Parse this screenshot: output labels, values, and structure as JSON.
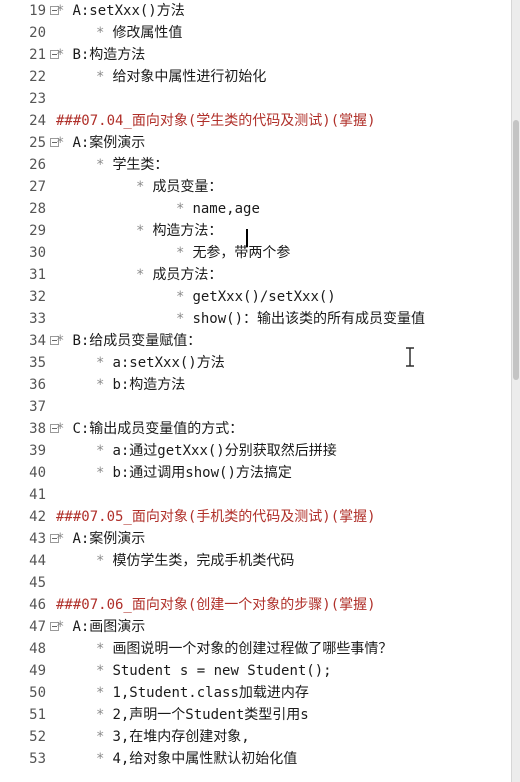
{
  "lines": [
    {
      "num": "19",
      "indent": 0,
      "bullet": "*",
      "text": "A:setXxx()方法",
      "heading": false,
      "fold": true
    },
    {
      "num": "20",
      "indent": 1,
      "bullet": "*",
      "text": "修改属性值",
      "heading": false,
      "fold": false
    },
    {
      "num": "21",
      "indent": 0,
      "bullet": "*",
      "text": "B:构造方法",
      "heading": false,
      "fold": true
    },
    {
      "num": "22",
      "indent": 1,
      "bullet": "*",
      "text": "给对象中属性进行初始化",
      "heading": false,
      "fold": false
    },
    {
      "num": "23",
      "indent": 0,
      "bullet": "",
      "text": "",
      "heading": false,
      "fold": false
    },
    {
      "num": "24",
      "indent": 0,
      "bullet": "",
      "text": "###07.04_面向对象(学生类的代码及测试)(掌握)",
      "heading": true,
      "fold": false
    },
    {
      "num": "25",
      "indent": 0,
      "bullet": "*",
      "text": "A:案例演示",
      "heading": false,
      "fold": true
    },
    {
      "num": "26",
      "indent": 1,
      "bullet": "*",
      "text": "学生类：",
      "heading": false,
      "fold": false
    },
    {
      "num": "27",
      "indent": 2,
      "bullet": "*",
      "text": "成员变量：",
      "heading": false,
      "fold": false
    },
    {
      "num": "28",
      "indent": 3,
      "bullet": "*",
      "text": "name,age",
      "heading": false,
      "fold": false
    },
    {
      "num": "29",
      "indent": 2,
      "bullet": "*",
      "text": "构造方法：",
      "heading": false,
      "fold": false
    },
    {
      "num": "30",
      "indent": 3,
      "bullet": "*",
      "text": "无参，带两个参",
      "heading": false,
      "fold": false
    },
    {
      "num": "31",
      "indent": 2,
      "bullet": "*",
      "text": "成员方法：",
      "heading": false,
      "fold": false
    },
    {
      "num": "32",
      "indent": 3,
      "bullet": "*",
      "text": "getXxx()/setXxx()",
      "heading": false,
      "fold": false
    },
    {
      "num": "33",
      "indent": 3,
      "bullet": "*",
      "text": "show()：输出该类的所有成员变量值",
      "heading": false,
      "fold": false
    },
    {
      "num": "34",
      "indent": 0,
      "bullet": "*",
      "text": "B:给成员变量赋值：",
      "heading": false,
      "fold": true
    },
    {
      "num": "35",
      "indent": 1,
      "bullet": "*",
      "text": "a:setXxx()方法",
      "heading": false,
      "fold": false
    },
    {
      "num": "36",
      "indent": 1,
      "bullet": "*",
      "text": "b:构造方法",
      "heading": false,
      "fold": false
    },
    {
      "num": "37",
      "indent": 0,
      "bullet": "",
      "text": "",
      "heading": false,
      "fold": false
    },
    {
      "num": "38",
      "indent": 0,
      "bullet": "*",
      "text": "C:输出成员变量值的方式：",
      "heading": false,
      "fold": true
    },
    {
      "num": "39",
      "indent": 1,
      "bullet": "*",
      "text": "a:通过getXxx()分别获取然后拼接",
      "heading": false,
      "fold": false
    },
    {
      "num": "40",
      "indent": 1,
      "bullet": "*",
      "text": "b:通过调用show()方法搞定",
      "heading": false,
      "fold": false
    },
    {
      "num": "41",
      "indent": 0,
      "bullet": "",
      "text": "",
      "heading": false,
      "fold": false
    },
    {
      "num": "42",
      "indent": 0,
      "bullet": "",
      "text": "###07.05_面向对象(手机类的代码及测试)(掌握)",
      "heading": true,
      "fold": false
    },
    {
      "num": "43",
      "indent": 0,
      "bullet": "*",
      "text": "A:案例演示",
      "heading": false,
      "fold": true
    },
    {
      "num": "44",
      "indent": 1,
      "bullet": "*",
      "text": "模仿学生类，完成手机类代码",
      "heading": false,
      "fold": false
    },
    {
      "num": "45",
      "indent": 0,
      "bullet": "",
      "text": "",
      "heading": false,
      "fold": false
    },
    {
      "num": "46",
      "indent": 0,
      "bullet": "",
      "text": "###07.06_面向对象(创建一个对象的步骤)(掌握)",
      "heading": true,
      "fold": false
    },
    {
      "num": "47",
      "indent": 0,
      "bullet": "*",
      "text": "A:画图演示",
      "heading": false,
      "fold": true
    },
    {
      "num": "48",
      "indent": 1,
      "bullet": "*",
      "text": "画图说明一个对象的创建过程做了哪些事情？",
      "heading": false,
      "fold": false
    },
    {
      "num": "49",
      "indent": 1,
      "bullet": "*",
      "text": "Student s = new Student();",
      "heading": false,
      "fold": false
    },
    {
      "num": "50",
      "indent": 1,
      "bullet": "*",
      "text": "1,Student.class加载进内存",
      "heading": false,
      "fold": false
    },
    {
      "num": "51",
      "indent": 1,
      "bullet": "*",
      "text": "2,声明一个Student类型引用s",
      "heading": false,
      "fold": false
    },
    {
      "num": "52",
      "indent": 1,
      "bullet": "*",
      "text": "3,在堆内存创建对象,",
      "heading": false,
      "fold": false
    },
    {
      "num": "53",
      "indent": 1,
      "bullet": "*",
      "text": "4,给对象中属性默认初始化值",
      "heading": false,
      "fold": false
    }
  ],
  "colors": {
    "heading": "#b0302a",
    "text": "#1a1a1a",
    "line_number": "#555555",
    "bullet": "#8a8a8a"
  },
  "icons": {
    "fold_marker": "fold-minus-icon",
    "mouse_pointer": "i-beam-cursor-icon"
  }
}
